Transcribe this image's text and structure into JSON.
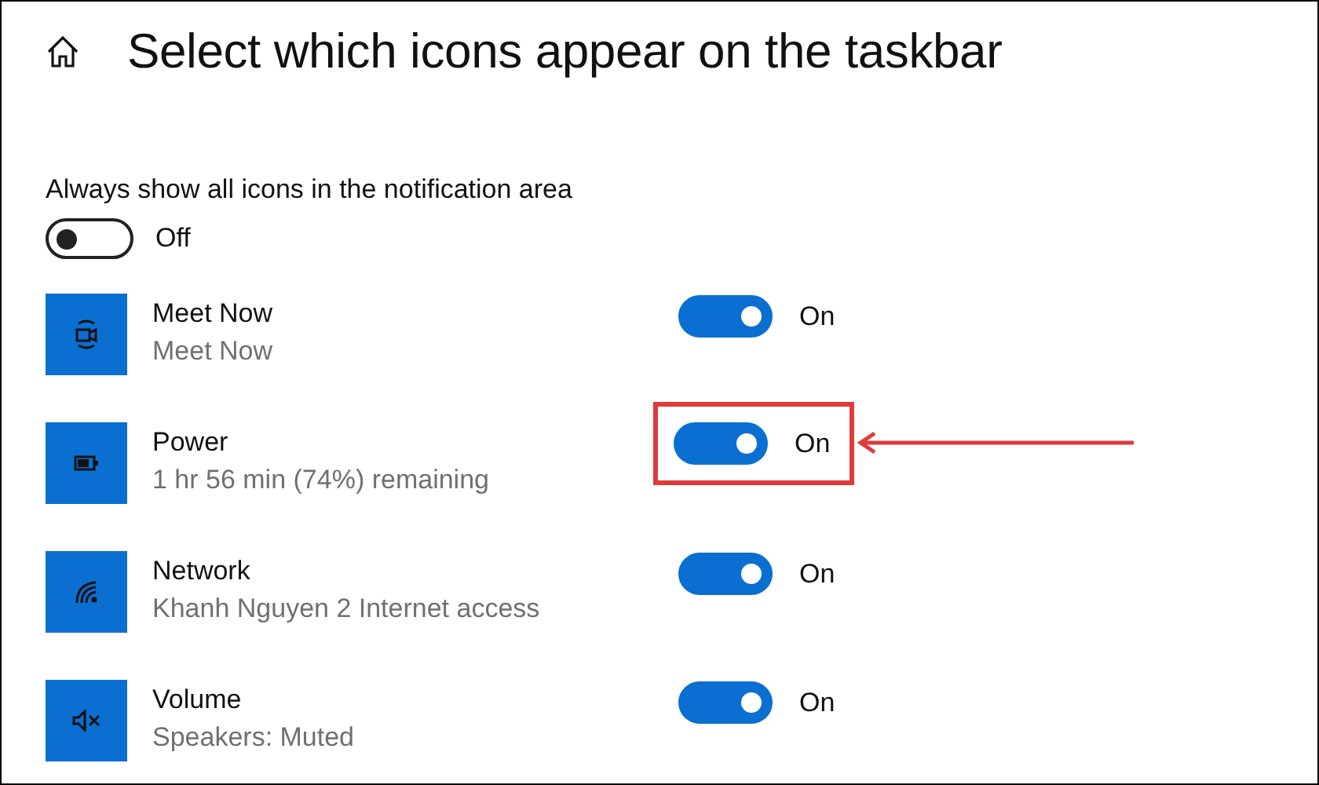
{
  "header": {
    "title": "Select which icons appear on the taskbar"
  },
  "always_show": {
    "label": "Always show all icons in the notification area",
    "on": false,
    "state_text": "Off"
  },
  "items": [
    {
      "kind": "camera",
      "name": "Meet Now",
      "detail": "Meet Now",
      "on": true,
      "state_text": "On",
      "highlighted": false
    },
    {
      "kind": "battery",
      "name": "Power",
      "detail": "1 hr 56 min (74%) remaining",
      "on": true,
      "state_text": "On",
      "highlighted": true
    },
    {
      "kind": "wifi",
      "name": "Network",
      "detail": "Khanh Nguyen 2 Internet access",
      "on": true,
      "state_text": "On",
      "highlighted": false
    },
    {
      "kind": "muted",
      "name": "Volume",
      "detail": "Speakers: Muted",
      "on": true,
      "state_text": "On",
      "highlighted": false
    }
  ]
}
